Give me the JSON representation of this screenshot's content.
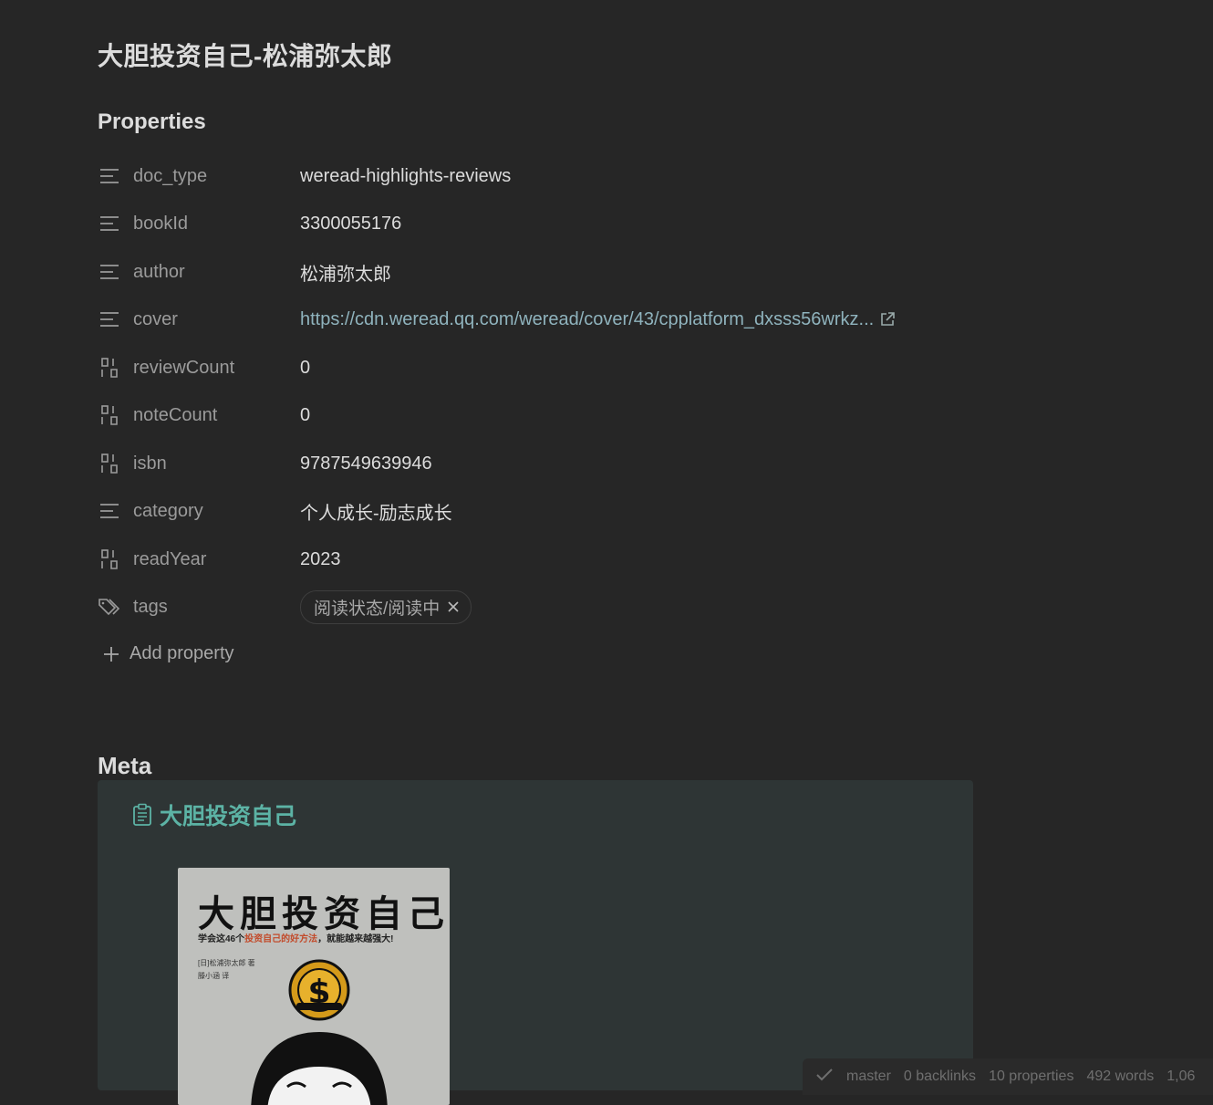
{
  "note": {
    "title": "大胆投资自己-松浦弥太郎"
  },
  "properties": {
    "heading": "Properties",
    "items": [
      {
        "key": "doc_type",
        "value": "weread-highlights-reviews",
        "icon": "text-lines-icon"
      },
      {
        "key": "bookId",
        "value": "3300055176",
        "icon": "text-lines-icon"
      },
      {
        "key": "author",
        "value": "松浦弥太郎",
        "icon": "text-lines-icon"
      },
      {
        "key": "cover",
        "value": "https://cdn.weread.qq.com/weread/cover/43/cpplatform_dxsss56wrkz...",
        "icon": "text-lines-icon"
      },
      {
        "key": "reviewCount",
        "value": "0",
        "icon": "number-icon"
      },
      {
        "key": "noteCount",
        "value": "0",
        "icon": "number-icon"
      },
      {
        "key": "isbn",
        "value": "9787549639946",
        "icon": "number-icon"
      },
      {
        "key": "category",
        "value": "个人成长-励志成长",
        "icon": "text-lines-icon"
      },
      {
        "key": "readYear",
        "value": "2023",
        "icon": "number-icon"
      },
      {
        "key": "tags",
        "value": "阅读状态/阅读中",
        "icon": "tags-icon"
      }
    ],
    "add_label": "Add property"
  },
  "meta": {
    "heading": "Meta",
    "book_title": "大胆投资自己",
    "cover": {
      "title": "大胆投资自己",
      "subtitle_pre": "学会这46个",
      "subtitle_highlight": "投资自己的好方法",
      "subtitle_post": "，就能越来越强大!",
      "author_line": "[日]松浦弥太郎  著",
      "translator_line": "滕小涵  译"
    }
  },
  "status_bar": {
    "branch": "master",
    "backlinks": "0 backlinks",
    "properties": "10 properties",
    "words": "492 words",
    "extra": "1,06"
  },
  "colors": {
    "accent": "#5cb3a5",
    "link": "#8fb3bd",
    "background": "#262626",
    "card": "#2e3535"
  }
}
